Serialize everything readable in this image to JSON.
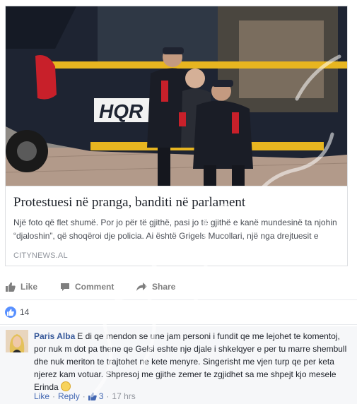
{
  "link_card": {
    "title": "Protestuesi në pranga, banditi në parlament",
    "description": "Një foto që flet shumë. Por jo për të gjithë, pasi jo të gjithë e kanë mundesinë ta njohin “djaloshin”, që shoqëroi dje policia. Ai është Grigels Mucollari, një nga drejtuesit e FRPD në vite, anëtar i Këshillit Kombëtar të PD-së. Është i martuar dhe…",
    "domain": "CITYNEWS.AL",
    "image_van_text": "HQR"
  },
  "actions": {
    "like": "Like",
    "comment": "Comment",
    "share": "Share"
  },
  "reactions": {
    "count": "14"
  },
  "comment": {
    "author": "Paris Alba",
    "text": "E di qe mendon se une jam personi i fundit qe me lejohet te komentoj, por nuk m dot pa thene qe Gelsi eshte nje djale i shkelqyer e per tu marre shembull dhe nuk meriton te trajtohet ne kete menyre. Singerisht me vjen turp qe per keta njerez kam votuar. Shpresoj me gjithe zemer te zgjidhet sa me shpejt kjo mesele Erinda",
    "like_label": "Like",
    "reply_label": "Reply",
    "likes_count": "3",
    "time": "17 hrs"
  },
  "colors": {
    "link_blue": "#365899",
    "like_blue": "#5890ff",
    "muted": "#90949c"
  }
}
